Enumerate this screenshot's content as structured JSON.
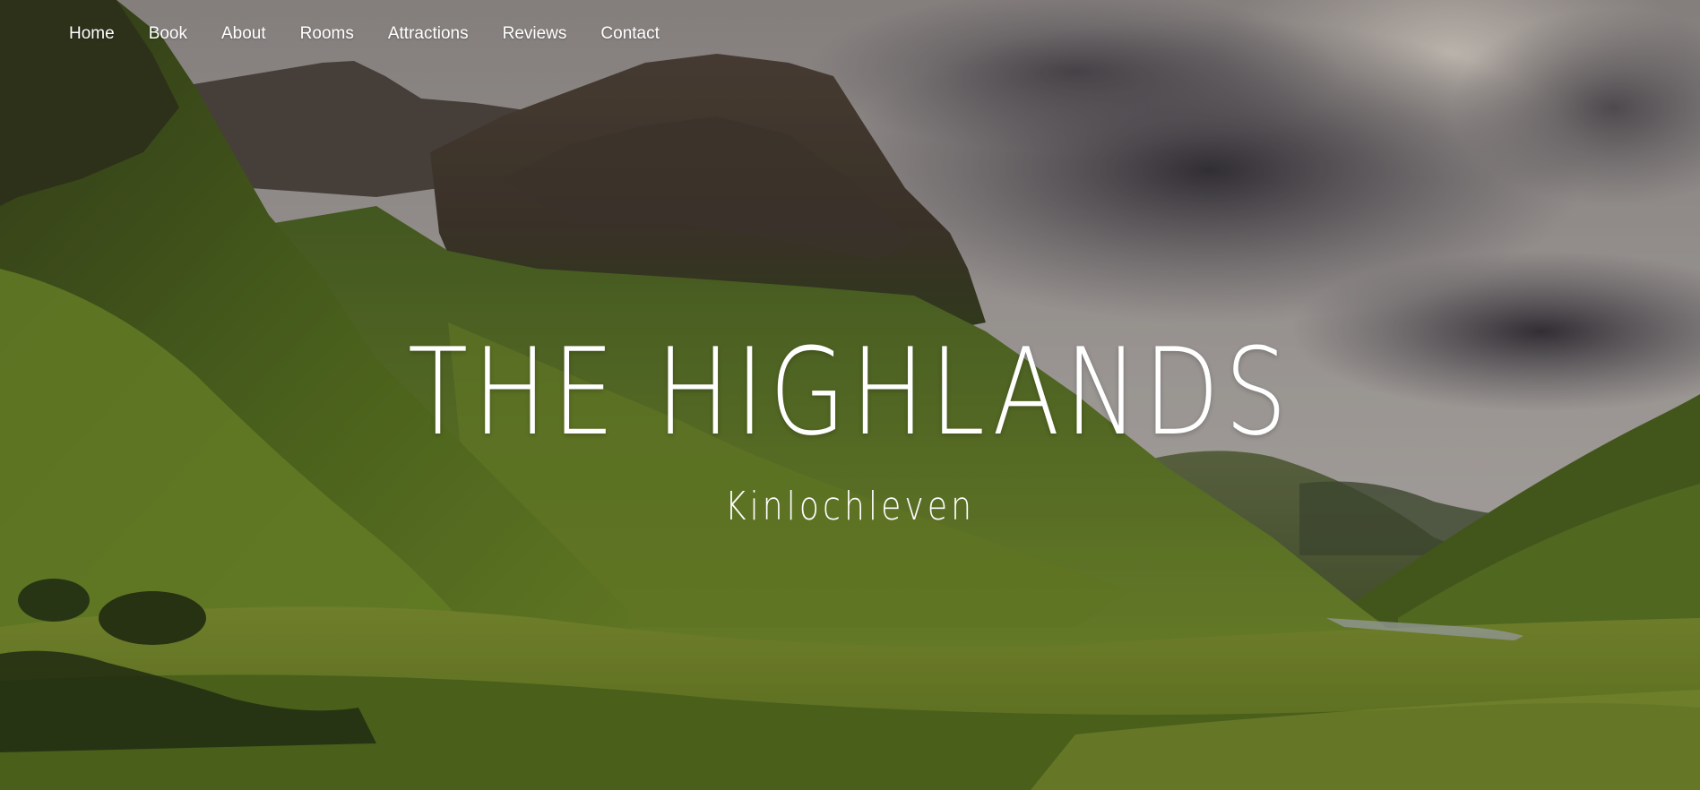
{
  "nav": {
    "items": [
      {
        "label": "Home"
      },
      {
        "label": "Book"
      },
      {
        "label": "About"
      },
      {
        "label": "Rooms"
      },
      {
        "label": "Attractions"
      },
      {
        "label": "Reviews"
      },
      {
        "label": "Contact"
      }
    ]
  },
  "hero": {
    "title": "THE HIGHLANDS",
    "subtitle": "Kinlochleven"
  },
  "colors": {
    "text": "#ffffff",
    "grass": "#6f8a2a",
    "mountain": "#4b4436",
    "sky": "#b7b0ad",
    "cloud": "#5e5a5e"
  }
}
